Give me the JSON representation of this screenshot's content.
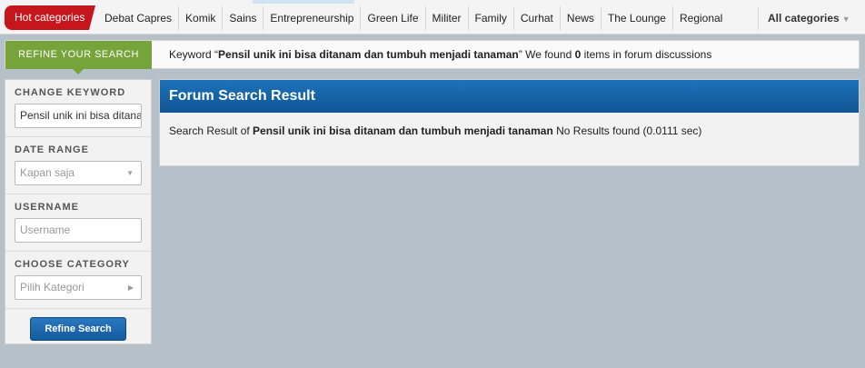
{
  "nav": {
    "hot_label": "Hot categories",
    "items": [
      "Debat Capres",
      "Komik",
      "Sains",
      "Entrepreneurship",
      "Green Life",
      "Militer",
      "Family",
      "Curhat",
      "News",
      "The Lounge",
      "Regional"
    ],
    "all_label": "All categories"
  },
  "refine": {
    "tab_label": "REFINE YOUR SEARCH",
    "keyword_prefix": "Keyword “",
    "keyword": "Pensil unik ini bisa ditanam dan tumbuh menjadi tanaman",
    "keyword_mid": "” We found ",
    "count": "0",
    "keyword_suffix": " items in forum discussions"
  },
  "sidebar": {
    "change_keyword_label": "CHANGE KEYWORD",
    "keyword_value": "Pensil unik ini bisa ditanam dan tumbuh menjadi tanaman",
    "date_range_label": "DATE RANGE",
    "date_range_value": "Kapan saja",
    "username_label": "USERNAME",
    "username_placeholder": "Username",
    "category_label": "CHOOSE CATEGORY",
    "category_value": "Pilih Kategori",
    "button_label": "Refine Search"
  },
  "results": {
    "title": "Forum Search Result",
    "prefix": "Search Result of ",
    "keyword": "Pensil unik ini bisa ditanam dan tumbuh menjadi tanaman",
    "suffix": " No Results found (0.0111 sec)"
  }
}
